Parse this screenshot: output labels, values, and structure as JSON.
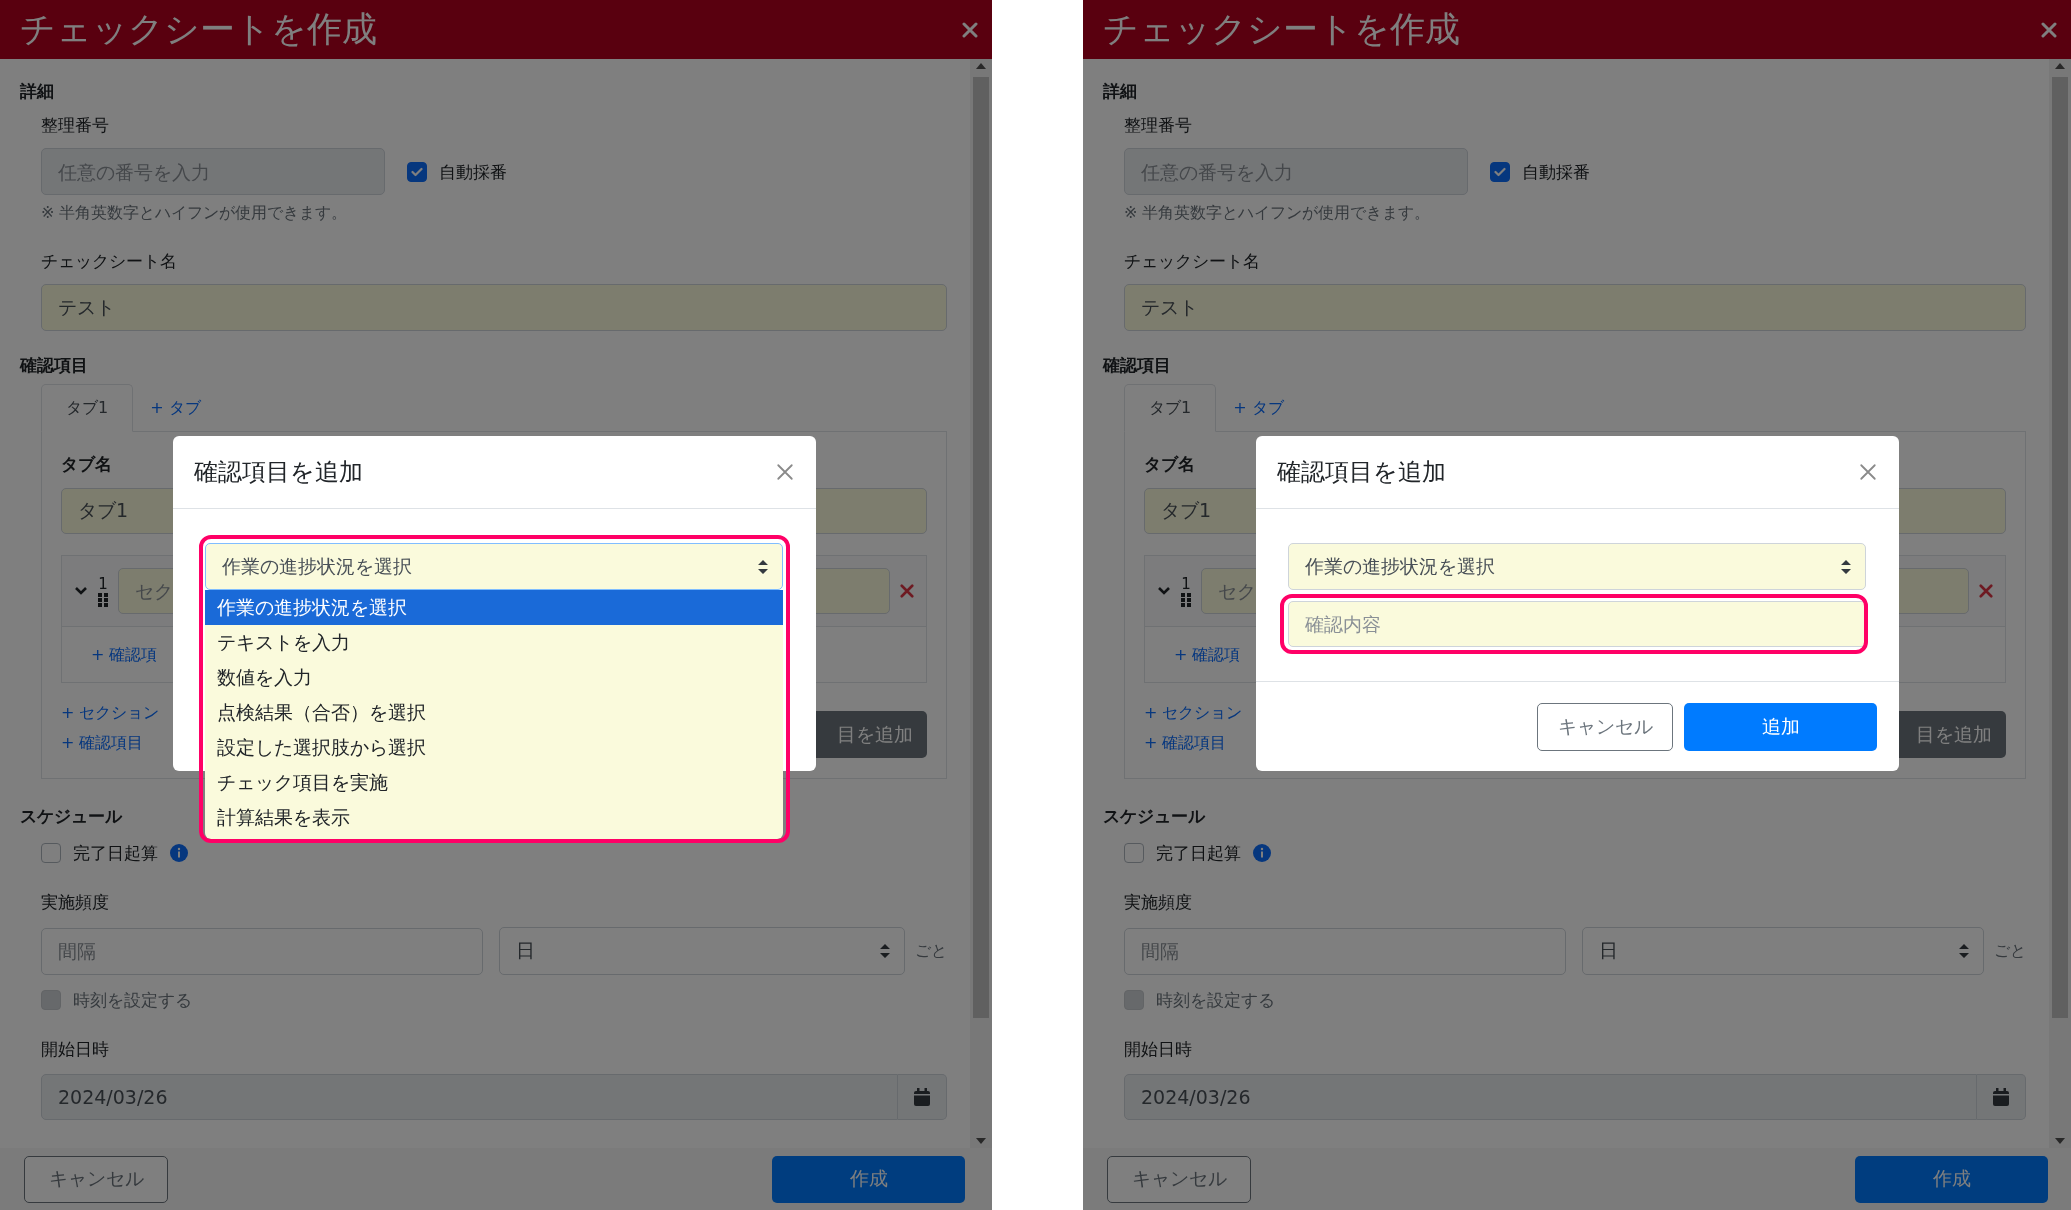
{
  "panels": [
    {
      "window": {
        "title": "チェックシートを作成"
      },
      "details": {
        "heading": "詳細",
        "number_label": "整理番号",
        "number_placeholder": "任意の番号を入力",
        "auto_number": {
          "label": "自動採番",
          "checked": true
        },
        "hint": "※ 半角英数字とハイフンが使用できます。",
        "name_label": "チェックシート名",
        "name_value": "テスト"
      },
      "items": {
        "heading": "確認項目",
        "tabs": [
          {
            "label": "タブ1",
            "selected": true
          }
        ],
        "add_tab": "+ タブ",
        "tab_name_label": "タブ名",
        "tab_name_value": "タブ1",
        "section": {
          "number": "1",
          "placeholder": "セク",
          "expanded": true
        },
        "add_item_inner": "+ 確認項",
        "add_section": "+ セクション",
        "add_item": "+ 確認項目",
        "add_item_button": "目を追加"
      },
      "schedule": {
        "heading": "スケジュール",
        "from_completion": {
          "label": "完了日起算",
          "checked": false
        },
        "frequency_label": "実施頻度",
        "interval_placeholder": "間隔",
        "unit_value": "日",
        "unit_suffix": "ごと",
        "set_time": {
          "label": "時刻を設定する",
          "checked": false,
          "disabled": true
        },
        "start_label": "開始日時",
        "start_value": "2024/03/26"
      },
      "footer": {
        "cancel": "キャンセル",
        "create": "作成"
      },
      "modal": {
        "title": "確認項目を追加",
        "select": {
          "value": "作業の進捗状況を選択",
          "expanded": true,
          "highlighted": true
        },
        "options": [
          {
            "label": "作業の進捗状況を選択",
            "selected": true
          },
          {
            "label": "テキストを入力",
            "selected": false
          },
          {
            "label": "数値を入力",
            "selected": false
          },
          {
            "label": "点検結果（合否）を選択",
            "selected": false
          },
          {
            "label": "設定した選択肢から選択",
            "selected": false
          },
          {
            "label": "チェック項目を実施",
            "selected": false
          },
          {
            "label": "計算結果を表示",
            "selected": false
          }
        ]
      }
    },
    {
      "window": {
        "title": "チェックシートを作成"
      },
      "details": {
        "heading": "詳細",
        "number_label": "整理番号",
        "number_placeholder": "任意の番号を入力",
        "auto_number": {
          "label": "自動採番",
          "checked": true
        },
        "hint": "※ 半角英数字とハイフンが使用できます。",
        "name_label": "チェックシート名",
        "name_value": "テスト"
      },
      "items": {
        "heading": "確認項目",
        "tabs": [
          {
            "label": "タブ1",
            "selected": true
          }
        ],
        "add_tab": "+ タブ",
        "tab_name_label": "タブ名",
        "tab_name_value": "タブ1",
        "section": {
          "number": "1",
          "placeholder": "セク",
          "expanded": true
        },
        "add_item_inner": "+ 確認項",
        "add_section": "+ セクション",
        "add_item": "+ 確認項目",
        "add_item_button": "目を追加"
      },
      "schedule": {
        "heading": "スケジュール",
        "from_completion": {
          "label": "完了日起算",
          "checked": false
        },
        "frequency_label": "実施頻度",
        "interval_placeholder": "間隔",
        "unit_value": "日",
        "unit_suffix": "ごと",
        "set_time": {
          "label": "時刻を設定する",
          "checked": false,
          "disabled": true
        },
        "start_label": "開始日時",
        "start_value": "2024/03/26"
      },
      "footer": {
        "cancel": "キャンセル",
        "create": "作成"
      },
      "modal": {
        "title": "確認項目を追加",
        "select": {
          "value": "作業の進捗状況を選択",
          "expanded": false,
          "highlighted": false
        },
        "content": {
          "placeholder": "確認内容",
          "highlighted": true
        },
        "buttons": {
          "cancel": "キャンセル",
          "add": "追加"
        }
      }
    }
  ]
}
